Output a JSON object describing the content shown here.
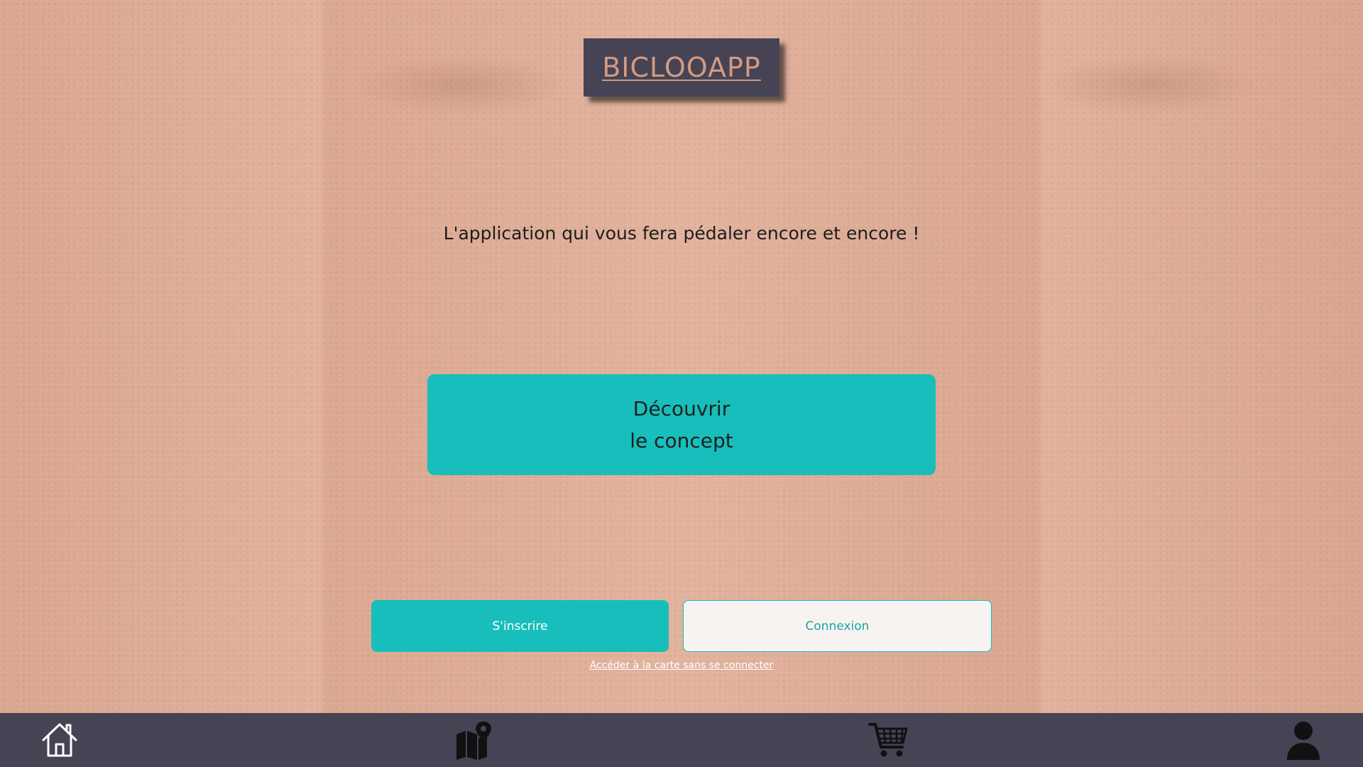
{
  "header": {
    "logo_text": "BICLOOAPP"
  },
  "hero": {
    "tagline": "L'application qui vous fera pédaler encore et encore !",
    "concept_button_line1": "Découvrir",
    "concept_button_line2": "le concept"
  },
  "auth": {
    "signup_label": "S'inscrire",
    "login_label": "Connexion",
    "guest_link": "Accéder à la carte sans se connecter"
  },
  "bottom_nav": {
    "items": [
      {
        "icon": "home-icon"
      },
      {
        "icon": "map-icon"
      },
      {
        "icon": "cart-icon"
      },
      {
        "icon": "user-icon"
      }
    ]
  },
  "colors": {
    "background": "#e0ad96",
    "accent_teal": "#17bebb",
    "nav_bar": "#464355",
    "logo_text": "#d49a7f"
  }
}
